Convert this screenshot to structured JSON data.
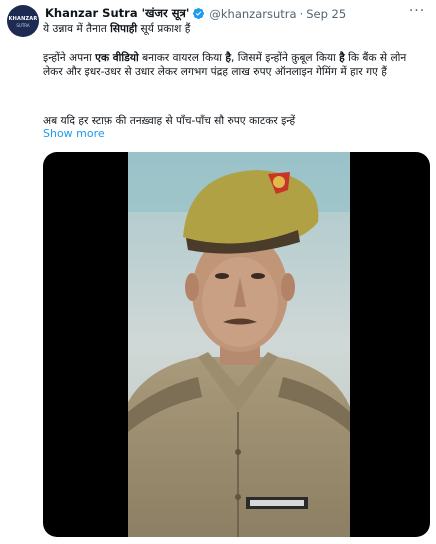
{
  "tweet": {
    "author_name": "Khanzar Sutra 'खंजर सूत्र'",
    "handle": "@khanzarsutra",
    "separator": "·",
    "date": "Sep 25",
    "avatar_text_top": "KHANZAR",
    "avatar_text_bottom": "SUTRA",
    "line1_plain": "ये उन्नाव में तैनात ",
    "line1_bold": "सिपाही",
    "line1_tail": " सूर्य प्रकाश हैं",
    "line2_a": "इन्होंने अपना ",
    "line2_bold1": "एक वीडियो",
    "line2_b": " बनाकर वायरल किया ",
    "line2_bold2": "है",
    "line2_c": ", जिसमें इन्होंने क़ुबूल किया ",
    "line2_bold3": "है",
    "line2_d": " कि बैंक से लोन लेकर और इधर-उधर से उधार लेकर लगभग पंद्रह लाख रुपए ऑनलाइन गेमिंग में हार गए हैं",
    "line3": "अब यदि हर स्टाफ़ की तनख़्वाह से पाँच-पाँच सौ रुपए काटकर इन्हें",
    "show_more": "Show more",
    "more_icon": "ellipsis-icon",
    "verified_color": "#1d9bf0"
  }
}
